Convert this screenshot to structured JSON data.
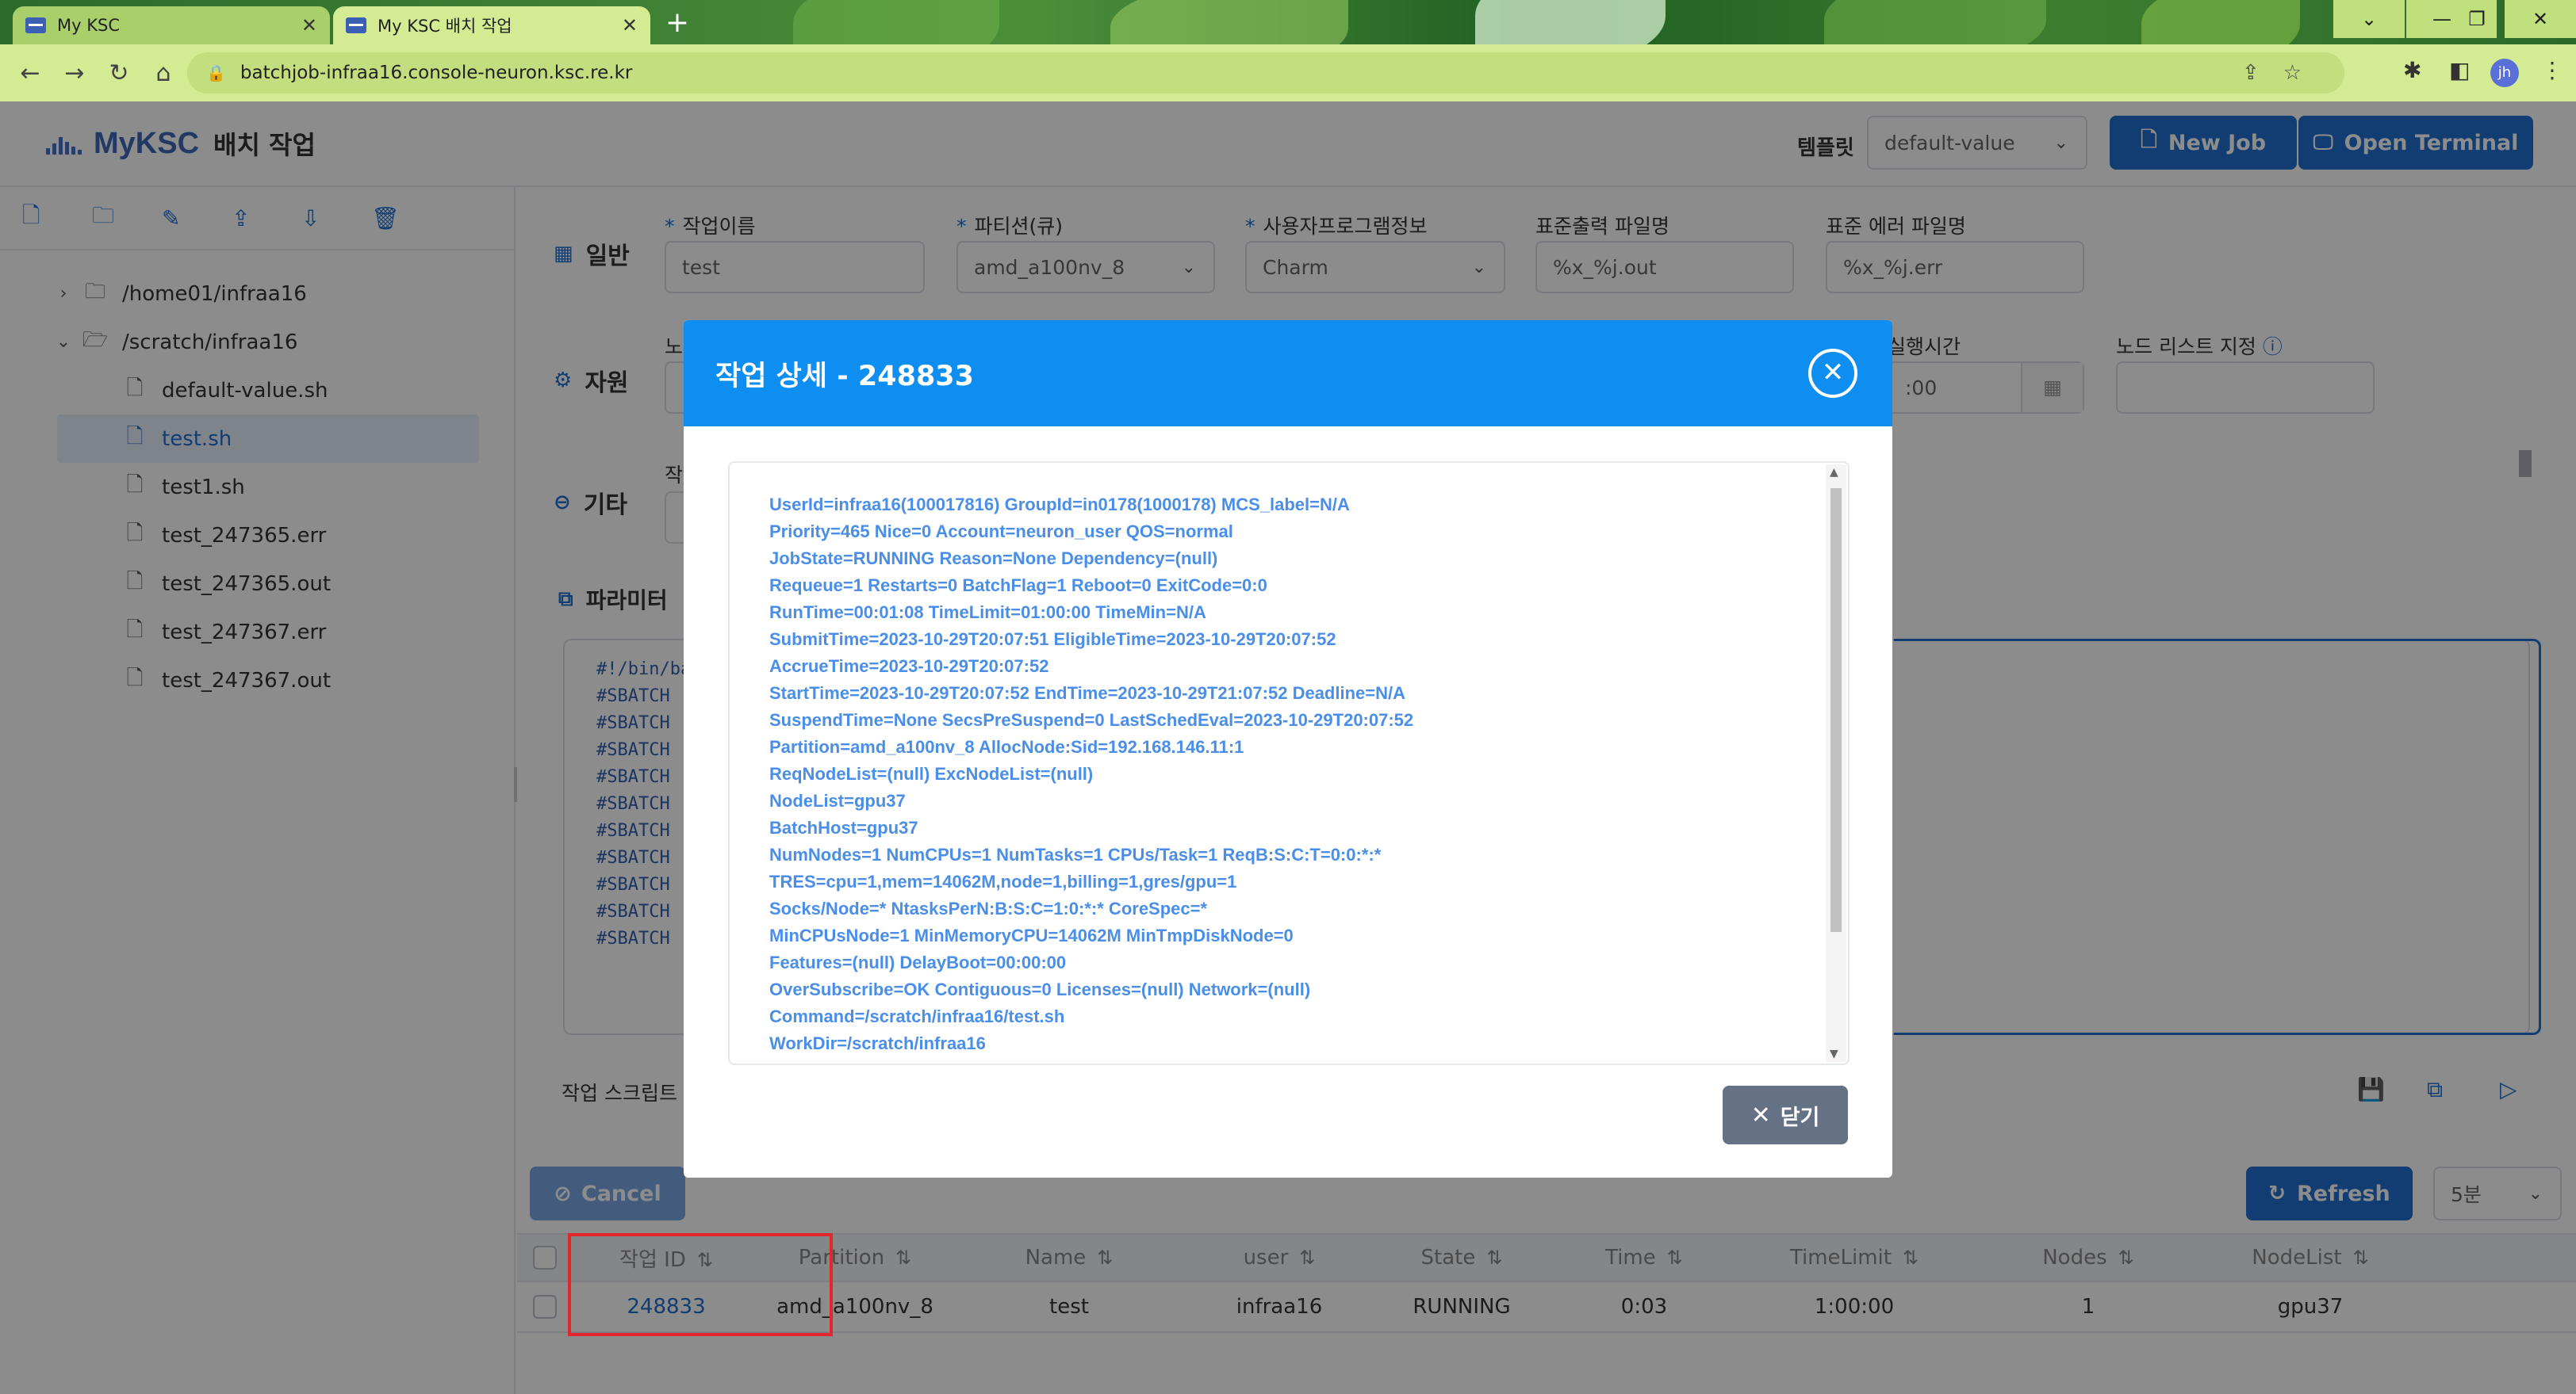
{
  "browser": {
    "tabs": [
      {
        "title": "My KSC"
      },
      {
        "title": "My KSC 배치 작업"
      }
    ],
    "url": "batchjob-infraa16.console-neuron.ksc.re.kr",
    "profile_initials": "jh"
  },
  "header": {
    "brand": "MyKSC",
    "subtitle": "배치 작업",
    "template_label": "템플릿",
    "template_value": "default-value",
    "new_job_label": "New Job",
    "open_terminal_label": "Open Terminal"
  },
  "sidebar": {
    "tree": [
      {
        "name": "/home01/infraa16",
        "type": "folder",
        "expanded": false
      },
      {
        "name": "/scratch/infraa16",
        "type": "folder",
        "expanded": true
      },
      {
        "name": "default-value.sh",
        "type": "file"
      },
      {
        "name": "test.sh",
        "type": "file",
        "selected": true
      },
      {
        "name": "test1.sh",
        "type": "file"
      },
      {
        "name": "test_247365.err",
        "type": "file"
      },
      {
        "name": "test_247365.out",
        "type": "file"
      },
      {
        "name": "test_247367.err",
        "type": "file"
      },
      {
        "name": "test_247367.out",
        "type": "file"
      }
    ]
  },
  "form": {
    "general_title": "일반",
    "job_name_label": "작업이름",
    "job_name_value": "test",
    "partition_label": "파티션(큐)",
    "partition_value": "amd_a100nv_8",
    "program_label": "사용자프로그램정보",
    "program_value": "Charm",
    "stdout_label": "표준출력 파일명",
    "stdout_value": "%x_%j.out",
    "stderr_label": "표준 에러 파일명",
    "stderr_value": "%x_%j.err",
    "resources_title": "자원",
    "resources_first_label_fragment": "노",
    "runtime_label_fragment": "실행시간",
    "runtime_value_fragment": ":00",
    "nodelist_label": "노드 리스트 지정",
    "misc_title": "기타",
    "misc_label_fragment": "작",
    "params_title_fragment": "파라미터",
    "script_lines": [
      "#!/bin/bas",
      "#SBATCH",
      "#SBATCH",
      "#SBATCH",
      "#SBATCH",
      "#SBATCH",
      "#SBATCH",
      "#SBATCH",
      "#SBATCH",
      "#SBATCH",
      "#SBATCH"
    ],
    "script_label_fragment": "작업 스크립트"
  },
  "jobs": {
    "cancel_label": "Cancel",
    "refresh_label": "Refresh",
    "interval_value": "5분",
    "columns": [
      "작업 ID",
      "Partition",
      "Name",
      "user",
      "State",
      "Time",
      "TimeLimit",
      "Nodes",
      "NodeList"
    ],
    "rows": [
      {
        "id": "248833",
        "partition": "amd_a100nv_8",
        "name": "test",
        "user": "infraa16",
        "state": "RUNNING",
        "time": "0:03",
        "timelimit": "1:00:00",
        "nodes": "1",
        "nodelist": "gpu37"
      }
    ]
  },
  "modal": {
    "title": "작업 상세 - 248833",
    "close_label": "닫기",
    "detail_lines": [
      "UserId=infraa16(100017816) GroupId=in0178(1000178) MCS_label=N/A",
      "Priority=465 Nice=0 Account=neuron_user QOS=normal",
      "JobState=RUNNING Reason=None Dependency=(null)",
      "Requeue=1 Restarts=0 BatchFlag=1 Reboot=0 ExitCode=0:0",
      "RunTime=00:01:08 TimeLimit=01:00:00 TimeMin=N/A",
      "SubmitTime=2023-10-29T20:07:51 EligibleTime=2023-10-29T20:07:52",
      "AccrueTime=2023-10-29T20:07:52",
      "StartTime=2023-10-29T20:07:52 EndTime=2023-10-29T21:07:52 Deadline=N/A",
      "SuspendTime=None SecsPreSuspend=0 LastSchedEval=2023-10-29T20:07:52",
      "Partition=amd_a100nv_8 AllocNode:Sid=192.168.146.11:1",
      "ReqNodeList=(null) ExcNodeList=(null)",
      "NodeList=gpu37",
      "BatchHost=gpu37",
      "NumNodes=1 NumCPUs=1 NumTasks=1 CPUs/Task=1 ReqB:S:C:T=0:0:*:*",
      "TRES=cpu=1,mem=14062M,node=1,billing=1,gres/gpu=1",
      "Socks/Node=* NtasksPerN:B:S:C=1:0:*:* CoreSpec=*",
      "MinCPUsNode=1 MinMemoryCPU=14062M MinTmpDiskNode=0",
      "Features=(null) DelayBoot=00:00:00",
      "OverSubscribe=OK Contiguous=0 Licenses=(null) Network=(null)",
      "Command=/scratch/infraa16/test.sh",
      "WorkDir=/scratch/infraa16"
    ]
  }
}
